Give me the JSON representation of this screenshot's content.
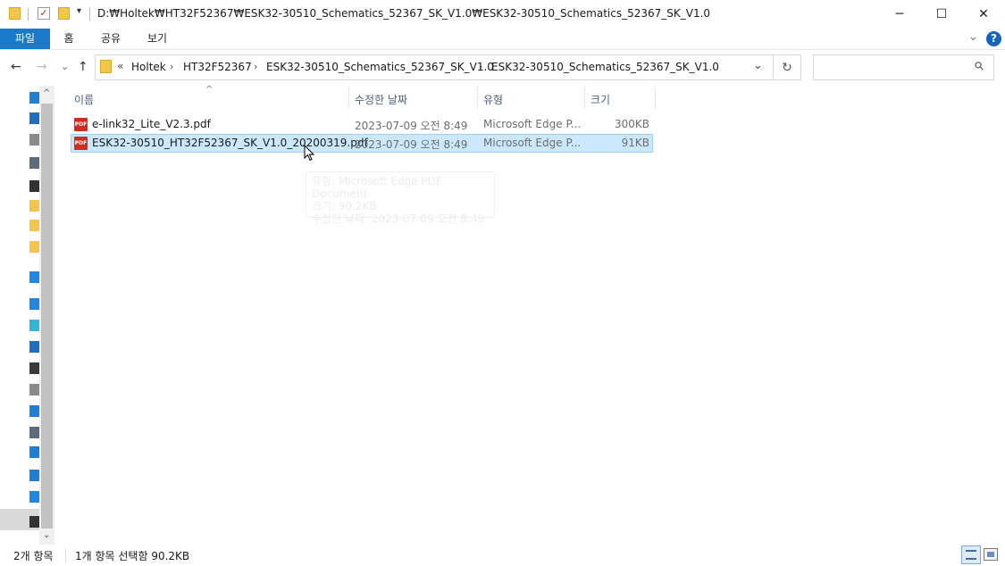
{
  "window": {
    "title": "D:₩Holtek₩HT32F52367₩ESK32-30510_Schematics_52367_SK_V1.0₩ESK32-30510_Schematics_52367_SK_V1.0",
    "minimize_glyph": "─",
    "maximize_glyph": "☐",
    "close_glyph": "✕"
  },
  "ribbon": {
    "tabs": [
      "파일",
      "홈",
      "공유",
      "보기"
    ],
    "expand_glyph": "⌄",
    "help_glyph": "?"
  },
  "address": {
    "back_glyph": "←",
    "forward_glyph": "→",
    "recent_glyph": "⌄",
    "up_glyph": "↑",
    "overflow_glyph": "«",
    "crumbs": [
      "Holtek",
      "HT32F52367",
      "ESK32-30510_Schematics_52367_SK_V1.0",
      "ESK32-30510_Schematics_52367_SK_V1.0"
    ],
    "separator": "›",
    "dropdown_glyph": "⌄",
    "refresh_glyph": "↻",
    "search_placeholder": "",
    "search_glyph": "⚲"
  },
  "file_list": {
    "sort_indicator": "^",
    "columns": {
      "name": "이름",
      "modified": "수정한 날짜",
      "type": "유형",
      "size": "크기"
    },
    "rows": [
      {
        "name": "e-link32_Lite_V2.3.pdf",
        "modified": "2023-07-09 오전 8:49",
        "type": "Microsoft Edge P...",
        "size": "300KB",
        "selected": false
      },
      {
        "name": "ESK32-30510_HT32F52367_SK_V1.0_20200319.pdf",
        "modified": "2023-07-09 오전 8:49",
        "type": "Microsoft Edge P...",
        "size": "91KB",
        "selected": true
      }
    ],
    "file_icon_label": "PDF"
  },
  "tooltip": {
    "lines": [
      "유형: Microsoft Edge PDF Document",
      "크기: 90.2KB",
      "수정한 날짜: 2023-07-09 오전 8:49"
    ]
  },
  "nav_pane": {
    "scroll_up_glyph": "^",
    "scroll_down_glyph": "⌄",
    "icon_colors": [
      "#1e7fd8",
      "#1e6fc0",
      "#8a8a8a",
      "#5f6b7a",
      "#333333",
      "#f3c64a",
      "#f3c64a",
      "#f3c64a",
      "#1e88e5",
      "#1e88e5",
      "#2fb6d8",
      "#1e6fc0",
      "#3a3a3a",
      "#8a8a8a",
      "#1e7fd8",
      "#5f6b7a",
      "#1e7fd8",
      "#1e7fd8",
      "#1e88e5",
      "#333333"
    ]
  },
  "status": {
    "item_count": "2개 항목",
    "selection": "1개 항목 선택함 90.2KB"
  },
  "colors": {
    "accent": "#1979ca",
    "selection_bg": "#cce8ff",
    "selection_border": "#99d1ff",
    "folder": "#f3c64a",
    "pdf": "#d42b1f"
  }
}
